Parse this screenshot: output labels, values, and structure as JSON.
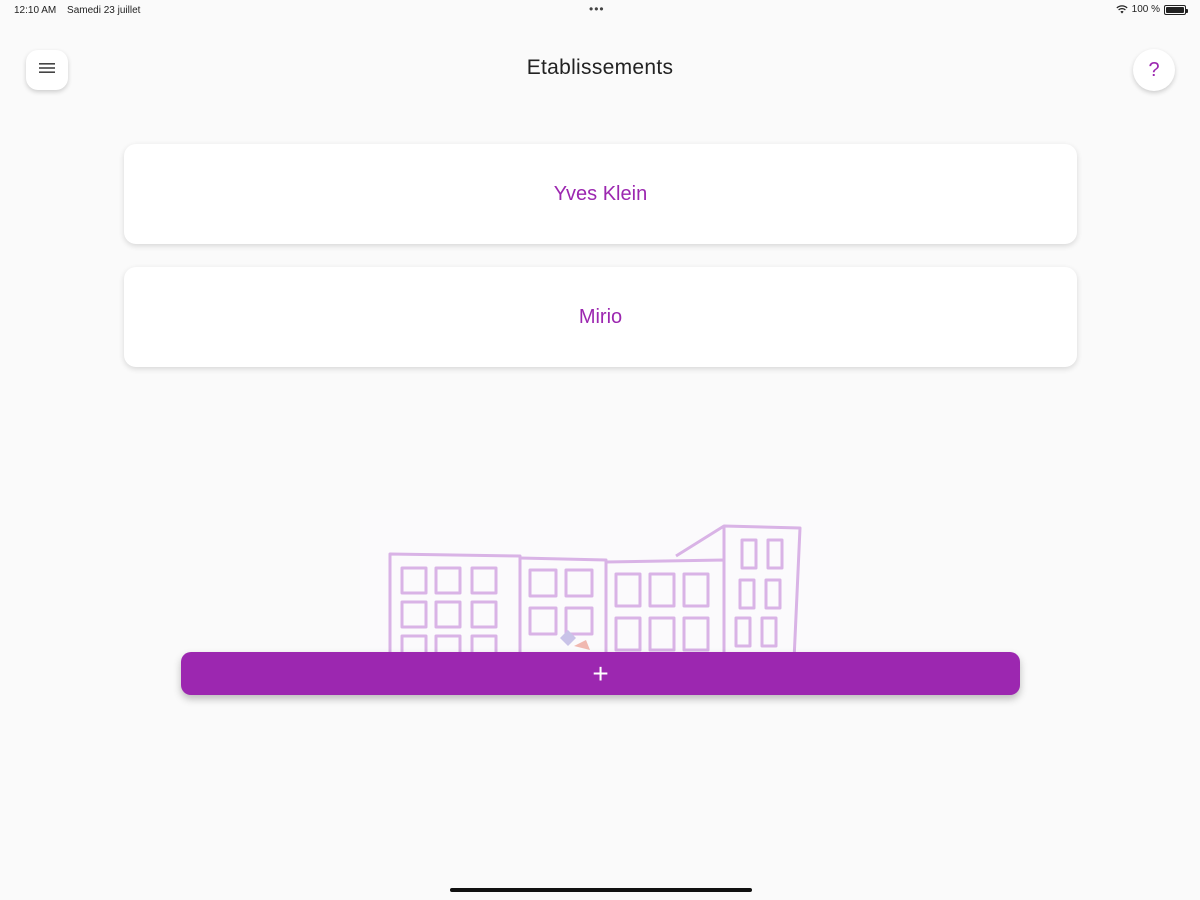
{
  "status_bar": {
    "time": "12:10 AM",
    "date": "Samedi 23 juillet",
    "dots": "•••",
    "battery": "100 %"
  },
  "header": {
    "title": "Etablissements",
    "menu_icon": "hamburger-menu-icon",
    "help_label": "?"
  },
  "establishments": [
    {
      "name": "Yves Klein"
    },
    {
      "name": "Mirio"
    }
  ],
  "add_button": {
    "label": "+"
  },
  "colors": {
    "accent": "#9c27b0",
    "background": "#fafafa",
    "card": "#ffffff"
  }
}
